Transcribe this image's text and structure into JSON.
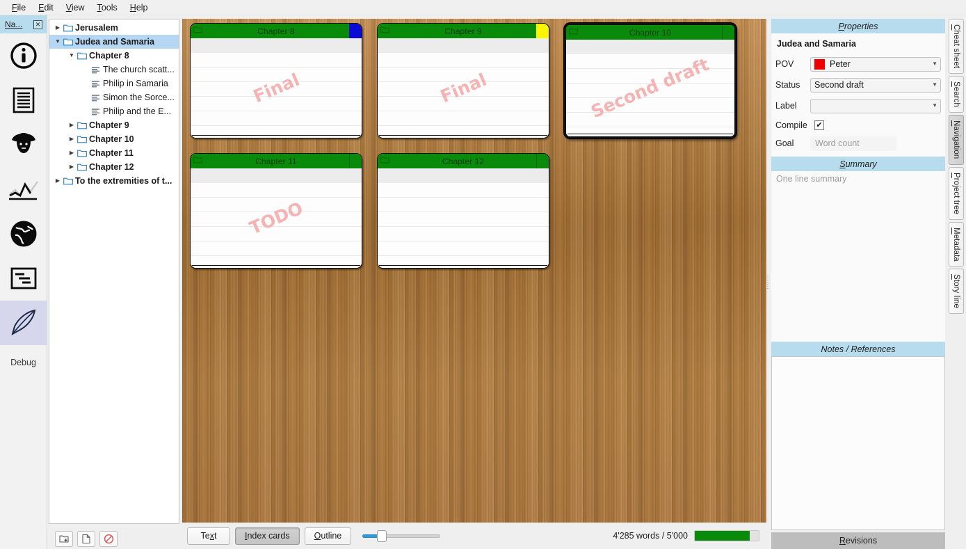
{
  "menu": {
    "items": [
      {
        "pre": "",
        "mn": "F",
        "post": "ile"
      },
      {
        "pre": "",
        "mn": "E",
        "post": "dit"
      },
      {
        "pre": "",
        "mn": "V",
        "post": "iew"
      },
      {
        "pre": "",
        "mn": "T",
        "post": "ools"
      },
      {
        "pre": "",
        "mn": "H",
        "post": "elp"
      }
    ]
  },
  "rail": {
    "tab_label": "Na...",
    "tab_mnemonic": "N",
    "tab_rest": "a...",
    "close_label": "☒",
    "debug_label": "Debug",
    "buttons": [
      {
        "name": "info-icon",
        "selected": false
      },
      {
        "name": "text-document-icon",
        "selected": false
      },
      {
        "name": "character-icon",
        "selected": false
      },
      {
        "name": "plot-chart-icon",
        "selected": false
      },
      {
        "name": "world-globe-icon",
        "selected": false
      },
      {
        "name": "outline-icon",
        "selected": false
      },
      {
        "name": "feather-quill-icon",
        "selected": true
      }
    ]
  },
  "tree": {
    "items": [
      {
        "label": "Jerusalem",
        "depth": 0,
        "arrow": "collapsed",
        "icon": "folder-icon",
        "bold": true,
        "selected": false
      },
      {
        "label": "Judea and Samaria",
        "depth": 0,
        "arrow": "expanded",
        "icon": "folder-icon",
        "bold": true,
        "selected": true
      },
      {
        "label": "Chapter 8",
        "depth": 1,
        "arrow": "expanded",
        "icon": "folder-icon",
        "bold": true,
        "selected": false
      },
      {
        "label": "The church scatt...",
        "depth": 2,
        "arrow": "none",
        "icon": "text-lines-icon",
        "bold": false,
        "selected": false
      },
      {
        "label": "Philip in Samaria",
        "depth": 2,
        "arrow": "none",
        "icon": "text-lines-icon",
        "bold": false,
        "selected": false
      },
      {
        "label": "Simon the Sorce...",
        "depth": 2,
        "arrow": "none",
        "icon": "text-lines-icon",
        "bold": false,
        "selected": false
      },
      {
        "label": "Philip and the E...",
        "depth": 2,
        "arrow": "none",
        "icon": "text-lines-icon",
        "bold": false,
        "selected": false
      },
      {
        "label": "Chapter 9",
        "depth": 1,
        "arrow": "collapsed",
        "icon": "folder-icon",
        "bold": true,
        "selected": false
      },
      {
        "label": "Chapter 10",
        "depth": 1,
        "arrow": "collapsed",
        "icon": "folder-icon",
        "bold": true,
        "selected": false
      },
      {
        "label": "Chapter 11",
        "depth": 1,
        "arrow": "collapsed",
        "icon": "folder-icon",
        "bold": true,
        "selected": false
      },
      {
        "label": "Chapter 12",
        "depth": 1,
        "arrow": "collapsed",
        "icon": "folder-icon",
        "bold": true,
        "selected": false
      },
      {
        "label": "To the extremities of t...",
        "depth": 0,
        "arrow": "collapsed",
        "icon": "folder-icon",
        "bold": true,
        "selected": false
      }
    ],
    "buttons": [
      {
        "name": "add-folder-button"
      },
      {
        "name": "add-text-button"
      },
      {
        "name": "delete-item-button"
      }
    ]
  },
  "corkboard": {
    "cards": [
      {
        "title": "Chapter 8",
        "watermark": "Final",
        "tag_color": "#0b0bd6",
        "has_tag": true,
        "selected": false
      },
      {
        "title": "Chapter 9",
        "watermark": "Final",
        "tag_color": "#fbf500",
        "has_tag": true,
        "selected": false
      },
      {
        "title": "Chapter 10",
        "watermark": "Second draft",
        "tag_color": "",
        "has_tag": false,
        "selected": true
      },
      {
        "title": "Chapter 11",
        "watermark": "TODO",
        "tag_color": "",
        "has_tag": false,
        "selected": false
      },
      {
        "title": "Chapter 12",
        "watermark": "",
        "tag_color": "",
        "has_tag": false,
        "selected": false
      }
    ],
    "header_color": "#0a8a0a",
    "watermark_color": "#f6b3b3"
  },
  "bottom": {
    "view_buttons": [
      {
        "pre": "Te",
        "mn": "x",
        "post": "t",
        "active": false
      },
      {
        "pre": "",
        "mn": "I",
        "post": "ndex cards",
        "active": true
      },
      {
        "pre": "",
        "mn": "O",
        "post": "utline",
        "active": false
      }
    ],
    "zoom_value": 25,
    "word_count_text": "4'285 words / 5'000",
    "word_count_percent": 86,
    "progress_color": "#0a8a0a"
  },
  "properties": {
    "header": "Properties",
    "header_mnemonic": "P",
    "header_rest": "roperties",
    "item_title": "Judea and Samaria",
    "pov": {
      "label": "POV",
      "value": "Peter",
      "swatch": "#ee0000"
    },
    "status": {
      "label": "Status",
      "value": "Second draft"
    },
    "label_row": {
      "label": "Label",
      "value": ""
    },
    "compile": {
      "label": "Compile",
      "checked": true,
      "check_glyph": "✔"
    },
    "goal": {
      "label": "Goal",
      "placeholder": "Word count",
      "value": ""
    }
  },
  "summary": {
    "header": "Summary",
    "header_mnemonic": "S",
    "header_rest": "ummary",
    "placeholder": "One line summary"
  },
  "notes": {
    "header": "Notes / References",
    "content": ""
  },
  "revisions": {
    "label": "Revisions",
    "mnemonic": "R",
    "rest": "evisions"
  },
  "vtabs": [
    {
      "pre": "",
      "mn": "C",
      "post": "heat sheet",
      "active": false
    },
    {
      "pre": "",
      "mn": "S",
      "post": "earch",
      "active": false
    },
    {
      "pre": "",
      "mn": "N",
      "post": "avigation",
      "active": true
    },
    {
      "pre": "",
      "mn": "P",
      "post": "roject tree",
      "active": false
    },
    {
      "pre": "",
      "mn": "M",
      "post": "etadata",
      "active": false
    },
    {
      "pre": "",
      "mn": "S",
      "post": "tory line",
      "active": false
    }
  ]
}
